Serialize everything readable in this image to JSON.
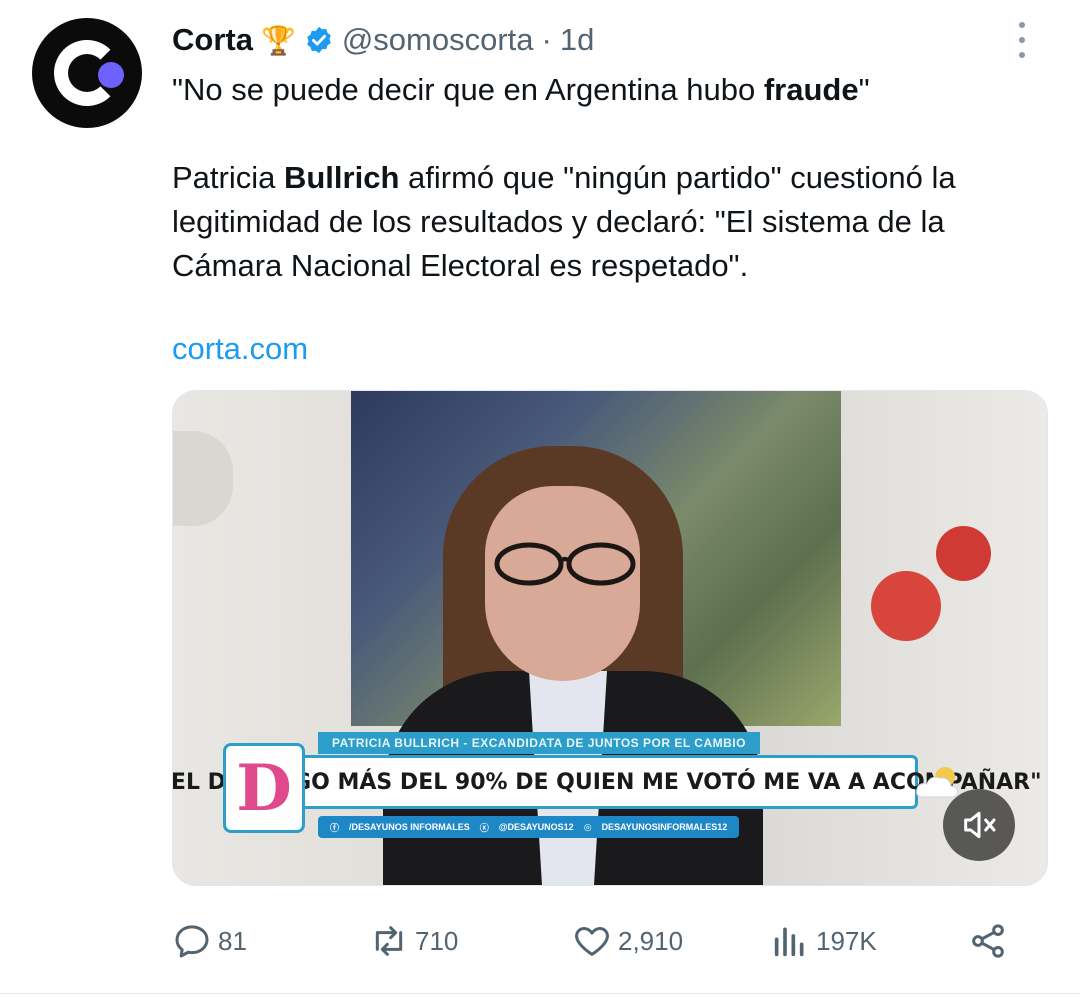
{
  "account": {
    "display_name": "Corta",
    "badge_emoji": "🏆",
    "handle": "@somoscorta",
    "separator": "·",
    "time": "1d"
  },
  "tweet": {
    "line1_pre": "\"No se puede decir que en Argentina hubo ",
    "line1_bold": "fraude",
    "line1_post": "\"",
    "para2_pre": "Patricia ",
    "para2_bold": "Bullrich",
    "para2_post": " afirmó que \"ningún partido\" cuestionó la legitimidad de los resultados y declaró: \"El sistema de la Cámara Nacional Electoral es respetado\".",
    "link": "corta.com"
  },
  "media": {
    "lower_third_tag": "PATRICIA BULLRICH - EXCANDIDATA DE JUNTOS POR EL CAMBIO",
    "lower_third_quote": "\"EL DOMINGO MÁS DEL 90% DE QUIEN ME VOTÓ ME VA A ACOMPAÑAR\"",
    "social_facebook": "/DESAYUNOS INFORMALES",
    "social_x": "@DESAYUNOS12",
    "social_instagram": "DESAYUNOSINFORMALES12",
    "show_logo_letter": "D",
    "mute_icon": "speaker-muted-icon"
  },
  "actions": {
    "replies": "81",
    "reposts": "710",
    "likes": "2,910",
    "views": "197K"
  },
  "colors": {
    "accent": "#1d9bf0",
    "muted_text": "#536471",
    "tv_blue": "#2d9ec9"
  }
}
